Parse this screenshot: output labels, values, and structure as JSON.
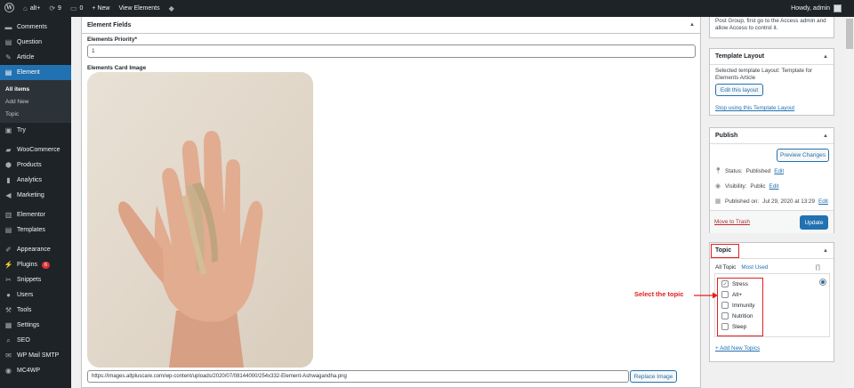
{
  "adminbar": {
    "wp_logo": "wordpress-icon",
    "site": "alt+",
    "updates_count": "9",
    "comments_count": "0",
    "new_label": "+ New",
    "view_label": "View Elements",
    "howdy": "Howdy, admin"
  },
  "sidebar": {
    "items_top": [
      {
        "label": "Comments",
        "icon": "comment-icon"
      },
      {
        "label": "Question",
        "icon": "question-icon"
      },
      {
        "label": "Article",
        "icon": "edit-icon"
      }
    ],
    "active": {
      "label": "Element",
      "icon": "element-icon"
    },
    "submenu": [
      "All items",
      "Add New",
      "Topic"
    ],
    "items_mid": [
      {
        "label": "Try",
        "icon": "lock-icon"
      }
    ],
    "items_woo": [
      {
        "label": "WooCommerce",
        "icon": "woocommerce-icon"
      },
      {
        "label": "Products",
        "icon": "products-icon"
      },
      {
        "label": "Analytics",
        "icon": "analytics-icon"
      },
      {
        "label": "Marketing",
        "icon": "megaphone-icon"
      }
    ],
    "items_elem": [
      {
        "label": "Elementor",
        "icon": "elementor-icon"
      },
      {
        "label": "Templates",
        "icon": "templates-icon"
      }
    ],
    "items_bottom": [
      {
        "label": "Appearance",
        "icon": "brush-icon"
      },
      {
        "label": "Plugins",
        "icon": "plugin-icon",
        "badge": "6"
      },
      {
        "label": "Snippets",
        "icon": "snippets-icon"
      },
      {
        "label": "Users",
        "icon": "users-icon"
      },
      {
        "label": "Tools",
        "icon": "tools-icon"
      },
      {
        "label": "Settings",
        "icon": "settings-icon"
      },
      {
        "label": "SEO",
        "icon": "seo-icon"
      },
      {
        "label": "WP Mail SMTP",
        "icon": "mail-icon"
      },
      {
        "label": "MC4WP",
        "icon": "mc4wp-icon"
      }
    ]
  },
  "main": {
    "section_title": "Element Fields",
    "priority_label": "Elements Priority*",
    "priority_value": "1",
    "image_label": "Elements Card Image",
    "image_url": "https://images.altpluscare.com/wp-content/uploads/2020/07/08144000/254x332-Element-Ashwagandha.png",
    "replace_label": "Replace Image"
  },
  "access_box": {
    "text": "Post Group, first go to the Access admin and allow Access to control it."
  },
  "template_box": {
    "title": "Template Layout",
    "selected": "Selected template Layout: Template for Elements Article",
    "edit_label": "Edit this layout",
    "stop_label": "Stop using this Template Layout"
  },
  "publish_box": {
    "title": "Publish",
    "preview_label": "Preview Changes",
    "status_label": "Status:",
    "status_value": "Published",
    "visibility_label": "Visibility:",
    "visibility_value": "Public",
    "published_label": "Published on:",
    "published_value": "Jul 29, 2020 at 13:29",
    "edit_link": "Edit",
    "trash_label": "Move to Trash",
    "update_label": "Update"
  },
  "topic_box": {
    "title": "Topic",
    "tab_all": "All Topic",
    "tab_most": "Most Used",
    "bracket": "[']",
    "items": [
      {
        "label": "Stress",
        "checked": true
      },
      {
        "label": "Alt+",
        "checked": false
      },
      {
        "label": "Immunity",
        "checked": false
      },
      {
        "label": "Nutrition",
        "checked": false
      },
      {
        "label": "Sleep",
        "checked": false
      }
    ],
    "add_new": "+ Add New Topics"
  },
  "annotation": {
    "text": "Select the topic",
    "color": "#e02020"
  },
  "colors": {
    "sidebar_bg": "#1d2327",
    "accent": "#2271b1",
    "annotation": "#e02020"
  }
}
